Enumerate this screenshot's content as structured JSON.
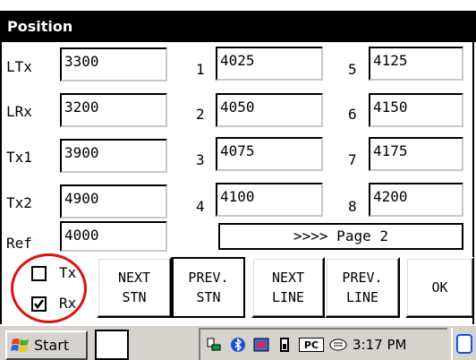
{
  "window": {
    "title": "Position"
  },
  "left_fields": [
    {
      "label": "LTx",
      "value": "3300"
    },
    {
      "label": "LRx",
      "value": "3200"
    },
    {
      "label": "Tx1",
      "value": "3900"
    },
    {
      "label": "Tx2",
      "value": "4900"
    },
    {
      "label": "Ref",
      "value": "4000"
    }
  ],
  "channels": [
    {
      "label": "1",
      "value": "4025"
    },
    {
      "label": "2",
      "value": "4050"
    },
    {
      "label": "3",
      "value": "4075"
    },
    {
      "label": "4",
      "value": "4100"
    },
    {
      "label": "5",
      "value": "4125"
    },
    {
      "label": "6",
      "value": "4150"
    },
    {
      "label": "7",
      "value": "4175"
    },
    {
      "label": "8",
      "value": "4200"
    }
  ],
  "page_button": {
    "label": ">>>> Page 2"
  },
  "checkboxes": [
    {
      "label": "Tx",
      "checked": false
    },
    {
      "label": "Rx",
      "checked": true
    }
  ],
  "buttons": {
    "next_stn": {
      "line1": "NEXT",
      "line2": "STN"
    },
    "prev_stn": {
      "line1": "PREV.",
      "line2": "STN"
    },
    "next_line": {
      "line1": "NEXT",
      "line2": "LINE"
    },
    "prev_line": {
      "line1": "PREV.",
      "line2": "LINE"
    },
    "ok": {
      "label": "OK"
    }
  },
  "taskbar": {
    "start_label": "Start",
    "tray_text": "PC",
    "clock": "3:17 PM"
  },
  "colors": {
    "title_bg": "#000000",
    "highlight_circle": "#e01010",
    "taskbar_bg": "#d6d3ce"
  }
}
